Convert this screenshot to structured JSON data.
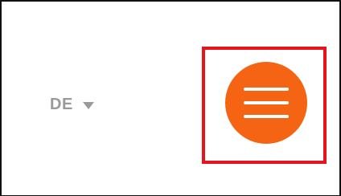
{
  "language": {
    "current": "DE",
    "caret_icon": "caret-down-icon"
  },
  "menu": {
    "icon": "hamburger-menu-icon",
    "button_color": "#f56412",
    "highlight_color": "#e8141b"
  }
}
